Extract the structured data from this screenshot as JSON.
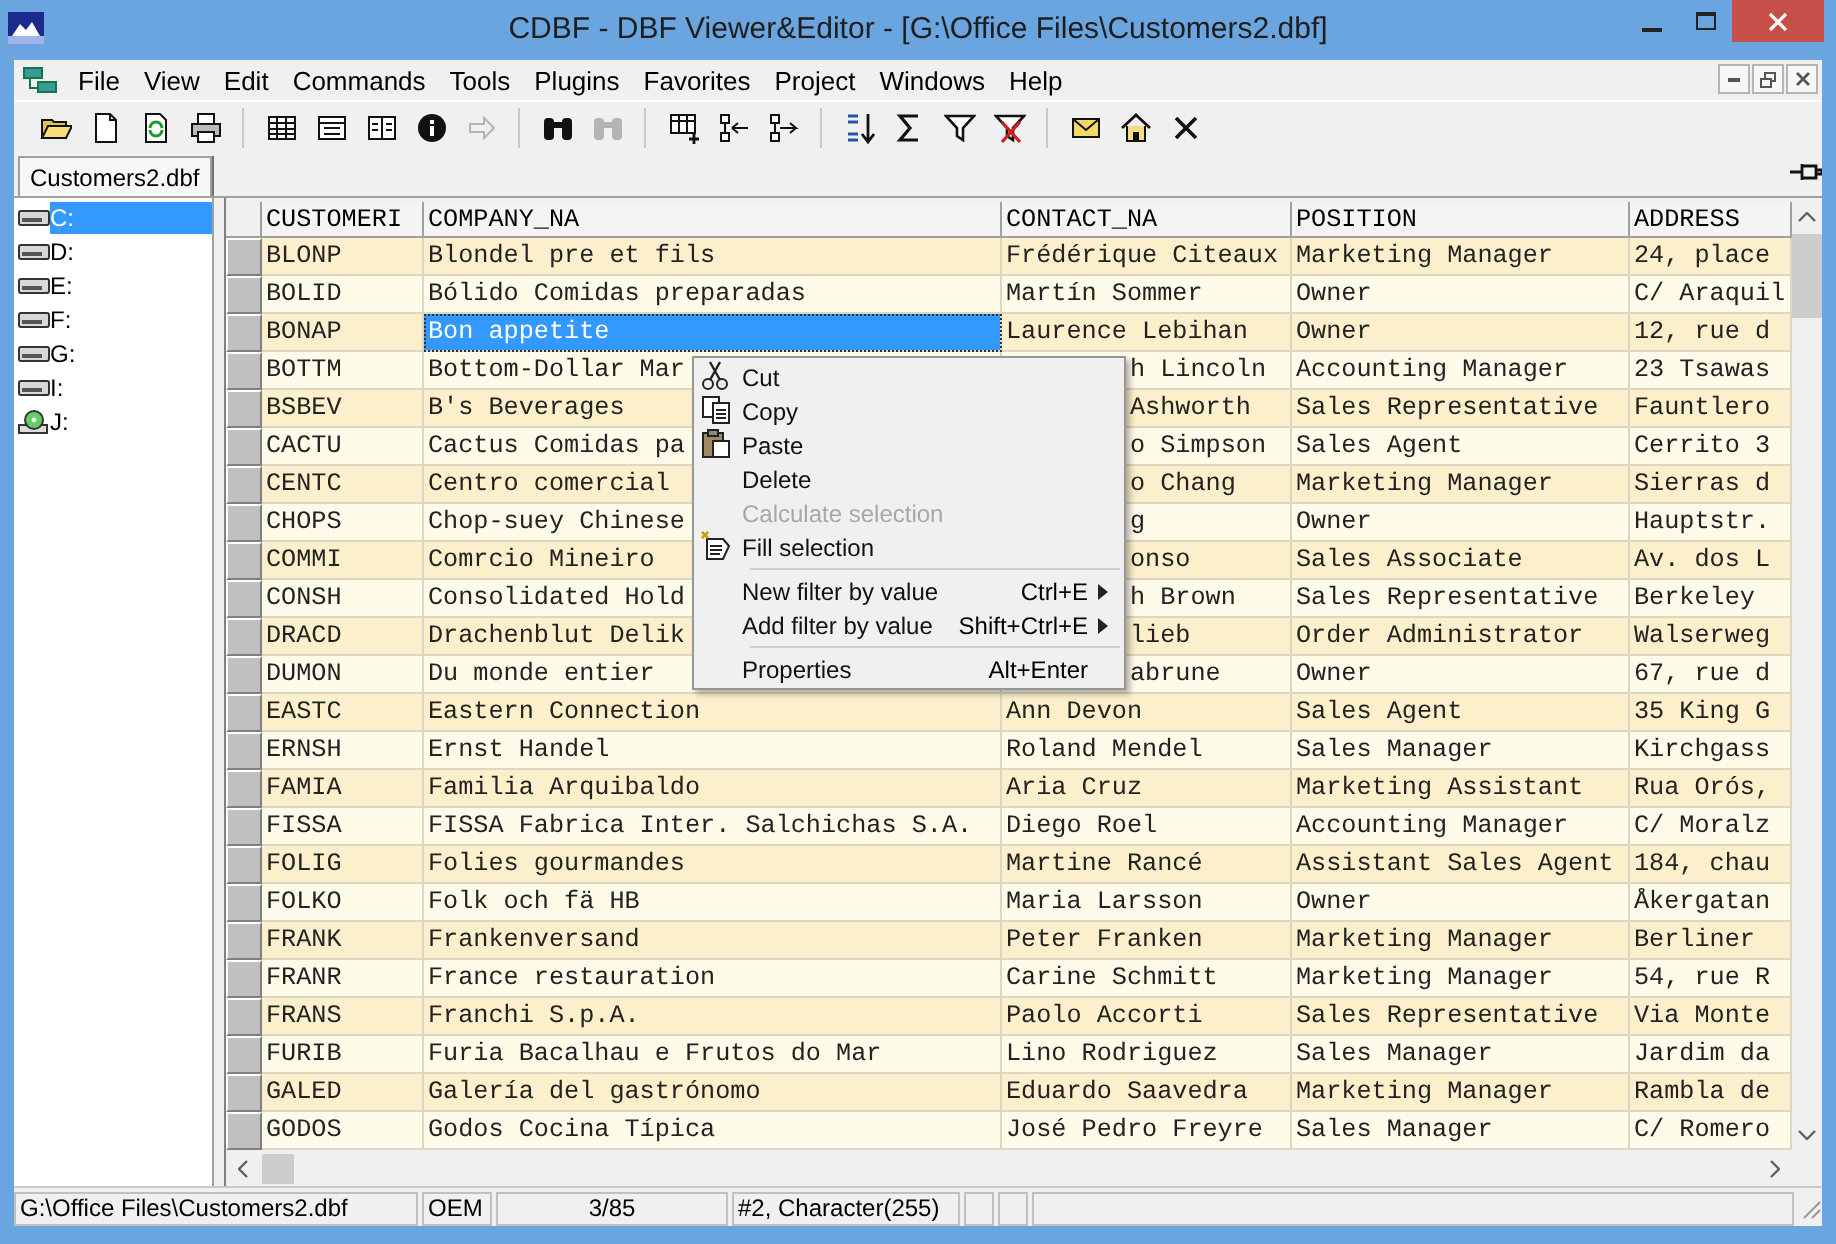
{
  "window": {
    "title": "CDBF - DBF Viewer&Editor - [G:\\Office Files\\Customers2.dbf]"
  },
  "menu": [
    "File",
    "View",
    "Edit",
    "Commands",
    "Tools",
    "Plugins",
    "Favorites",
    "Project",
    "Windows",
    "Help"
  ],
  "toolbar": [
    {
      "kind": "open",
      "disabled": false
    },
    {
      "kind": "new",
      "disabled": false
    },
    {
      "kind": "refresh",
      "disabled": false
    },
    {
      "kind": "print",
      "disabled": false
    },
    {
      "kind": "separator"
    },
    {
      "kind": "table",
      "disabled": false
    },
    {
      "kind": "form",
      "disabled": false
    },
    {
      "kind": "card",
      "disabled": false
    },
    {
      "kind": "info",
      "disabled": false
    },
    {
      "kind": "arrow",
      "disabled": true
    },
    {
      "kind": "separator"
    },
    {
      "kind": "find",
      "disabled": false
    },
    {
      "kind": "find",
      "disabled": true
    },
    {
      "kind": "separator"
    },
    {
      "kind": "gridadd",
      "disabled": false
    },
    {
      "kind": "moveleft",
      "disabled": false
    },
    {
      "kind": "moveright",
      "disabled": false
    },
    {
      "kind": "separator"
    },
    {
      "kind": "sort",
      "disabled": false
    },
    {
      "kind": "sum",
      "disabled": false
    },
    {
      "kind": "filter",
      "disabled": false
    },
    {
      "kind": "filterclear",
      "disabled": false
    },
    {
      "kind": "separator"
    },
    {
      "kind": "mail",
      "disabled": false
    },
    {
      "kind": "home",
      "disabled": false
    },
    {
      "kind": "close",
      "disabled": false
    }
  ],
  "tabs": [
    {
      "label": "Customers2.dbf",
      "selected": true
    }
  ],
  "drives": [
    {
      "label": "C:",
      "kind": "disk",
      "selected": true
    },
    {
      "label": "D:",
      "kind": "disk",
      "selected": false
    },
    {
      "label": "E:",
      "kind": "disk",
      "selected": false
    },
    {
      "label": "F:",
      "kind": "disk",
      "selected": false
    },
    {
      "label": "G:",
      "kind": "disk",
      "selected": false
    },
    {
      "label": "I:",
      "kind": "disk",
      "selected": false
    },
    {
      "label": "J:",
      "kind": "cd",
      "selected": false
    }
  ],
  "table": {
    "columns": [
      "CUSTOMERI",
      "COMPANY_NA",
      "CONTACT_NA",
      "POSITION",
      "ADDRESS"
    ],
    "rows": [
      {
        "id": "BLONP",
        "company": "Blondel pre et fils",
        "contact": "Frédérique Citeaux",
        "position": "Marketing Manager",
        "address": "24, place",
        "selected": false,
        "under_menu": false
      },
      {
        "id": "BOLID",
        "company": "Bólido Comidas preparadas",
        "contact": "Martín Sommer",
        "position": "Owner",
        "address": "C/ Araquil",
        "selected": false,
        "under_menu": false
      },
      {
        "id": "BONAP",
        "company": "Bon appetite",
        "contact": "Laurence Lebihan",
        "position": "Owner",
        "address": "12, rue d",
        "selected": true,
        "under_menu": false
      },
      {
        "id": "BOTTM",
        "company": "Bottom-Dollar Mar",
        "contact": "h Lincoln",
        "position": "Accounting Manager",
        "address": "23 Tsawas",
        "selected": false,
        "under_menu": true
      },
      {
        "id": "BSBEV",
        "company": "B's Beverages",
        "contact": "Ashworth",
        "position": "Sales Representative",
        "address": "Fauntlero",
        "selected": false,
        "under_menu": true
      },
      {
        "id": "CACTU",
        "company": "Cactus Comidas pa",
        "contact": "o Simpson",
        "position": "Sales Agent",
        "address": "Cerrito 3",
        "selected": false,
        "under_menu": true
      },
      {
        "id": "CENTC",
        "company": "Centro comercial",
        "contact": "o Chang",
        "position": "Marketing Manager",
        "address": "Sierras d",
        "selected": false,
        "under_menu": true
      },
      {
        "id": "CHOPS",
        "company": "Chop-suey Chinese",
        "contact": "g",
        "position": "Owner",
        "address": "Hauptstr.",
        "selected": false,
        "under_menu": true
      },
      {
        "id": "COMMI",
        "company": "Comrcio Mineiro",
        "contact": "onso",
        "position": "Sales Associate",
        "address": "Av. dos L",
        "selected": false,
        "under_menu": true
      },
      {
        "id": "CONSH",
        "company": "Consolidated Hold",
        "contact": "h Brown",
        "position": "Sales Representative",
        "address": "Berkeley",
        "selected": false,
        "under_menu": true
      },
      {
        "id": "DRACD",
        "company": "Drachenblut Delik",
        "contact": "lieb",
        "position": "Order Administrator",
        "address": "Walserweg",
        "selected": false,
        "under_menu": true
      },
      {
        "id": "DUMON",
        "company": "Du monde entier",
        "contact": "abrune",
        "position": "Owner",
        "address": "67, rue d",
        "selected": false,
        "under_menu": true
      },
      {
        "id": "EASTC",
        "company": "Eastern Connection",
        "contact": "Ann Devon",
        "position": "Sales Agent",
        "address": "35 King G",
        "selected": false,
        "under_menu": false
      },
      {
        "id": "ERNSH",
        "company": "Ernst Handel",
        "contact": "Roland Mendel",
        "position": "Sales Manager",
        "address": "Kirchgass",
        "selected": false,
        "under_menu": false
      },
      {
        "id": "FAMIA",
        "company": "Familia Arquibaldo",
        "contact": "Aria Cruz",
        "position": "Marketing Assistant",
        "address": "Rua Orós,",
        "selected": false,
        "under_menu": false
      },
      {
        "id": "FISSA",
        "company": "FISSA Fabrica Inter. Salchichas S.A.",
        "contact": "Diego Roel",
        "position": "Accounting Manager",
        "address": "C/ Moralz",
        "selected": false,
        "under_menu": false
      },
      {
        "id": "FOLIG",
        "company": "Folies gourmandes",
        "contact": "Martine Rancé",
        "position": "Assistant Sales Agent",
        "address": "184, chau",
        "selected": false,
        "under_menu": false
      },
      {
        "id": "FOLKO",
        "company": "Folk och fä HB",
        "contact": "Maria Larsson",
        "position": "Owner",
        "address": "Åkergatan",
        "selected": false,
        "under_menu": false
      },
      {
        "id": "FRANK",
        "company": "Frankenversand",
        "contact": "Peter Franken",
        "position": "Marketing Manager",
        "address": "Berliner",
        "selected": false,
        "under_menu": false
      },
      {
        "id": "FRANR",
        "company": "France restauration",
        "contact": "Carine Schmitt",
        "position": "Marketing Manager",
        "address": "54, rue R",
        "selected": false,
        "under_menu": false
      },
      {
        "id": "FRANS",
        "company": "Franchi S.p.A.",
        "contact": "Paolo Accorti",
        "position": "Sales Representative",
        "address": "Via Monte",
        "selected": false,
        "under_menu": false
      },
      {
        "id": "FURIB",
        "company": "Furia Bacalhau e Frutos do Mar",
        "contact": "Lino Rodriguez",
        "position": "Sales Manager",
        "address": "Jardim da",
        "selected": false,
        "under_menu": false
      },
      {
        "id": "GALED",
        "company": "Galería del gastrónomo",
        "contact": "Eduardo Saavedra",
        "position": "Marketing Manager",
        "address": "Rambla de",
        "selected": false,
        "under_menu": false
      },
      {
        "id": "GODOS",
        "company": "Godos Cocina Típica",
        "contact": "José Pedro Freyre",
        "position": "Sales Manager",
        "address": "C/ Romero",
        "selected": false,
        "under_menu": false
      }
    ]
  },
  "context_menu": [
    {
      "kind": "cut",
      "label": "Cut",
      "disabled": false
    },
    {
      "kind": "copy",
      "label": "Copy",
      "disabled": false
    },
    {
      "kind": "paste",
      "label": "Paste",
      "disabled": false
    },
    {
      "kind": "plain",
      "label": "Delete",
      "disabled": false
    },
    {
      "kind": "plain",
      "label": "Calculate selection",
      "disabled": true
    },
    {
      "kind": "fill",
      "label": "Fill selection",
      "disabled": false
    },
    {
      "kind": "separator"
    },
    {
      "kind": "plain",
      "label": "New filter by value",
      "shortcut": "Ctrl+E",
      "submenu": true,
      "disabled": false
    },
    {
      "kind": "plain",
      "label": "Add filter by value",
      "shortcut": "Shift+Ctrl+E",
      "submenu": true,
      "disabled": false
    },
    {
      "kind": "separator"
    },
    {
      "kind": "plain",
      "label": "Properties",
      "shortcut": "Alt+Enter",
      "disabled": false
    }
  ],
  "status_bar": {
    "path": "G:\\Office Files\\Customers2.dbf",
    "encoding": "OEM",
    "record": "3/85",
    "field": "#2, Character(255)"
  }
}
